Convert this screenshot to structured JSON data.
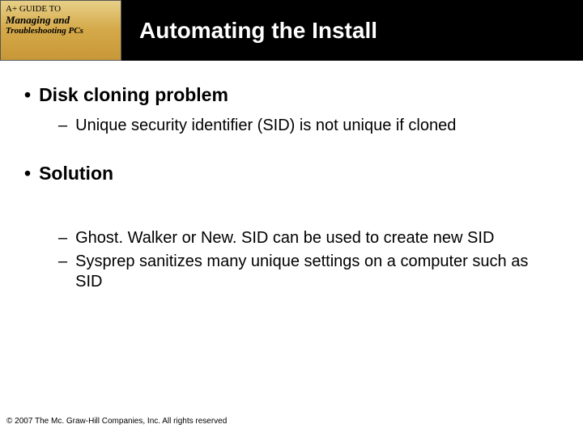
{
  "logo": {
    "top": "A+ GUIDE TO",
    "line1": "Managing and",
    "line2": "Troubleshooting PCs"
  },
  "title": "Automating the Install",
  "bullets": {
    "b1": {
      "label": "Disk cloning problem"
    },
    "b1_sub1": "Unique security identifier (SID) is not unique if cloned",
    "b2": {
      "label": "Solution"
    },
    "b2_sub1": "Ghost. Walker or New. SID can be used to create new SID",
    "b2_sub2": "Sysprep sanitizes many unique settings on a computer such as SID"
  },
  "footer": "© 2007 The Mc. Graw-Hill Companies, Inc. All rights reserved"
}
